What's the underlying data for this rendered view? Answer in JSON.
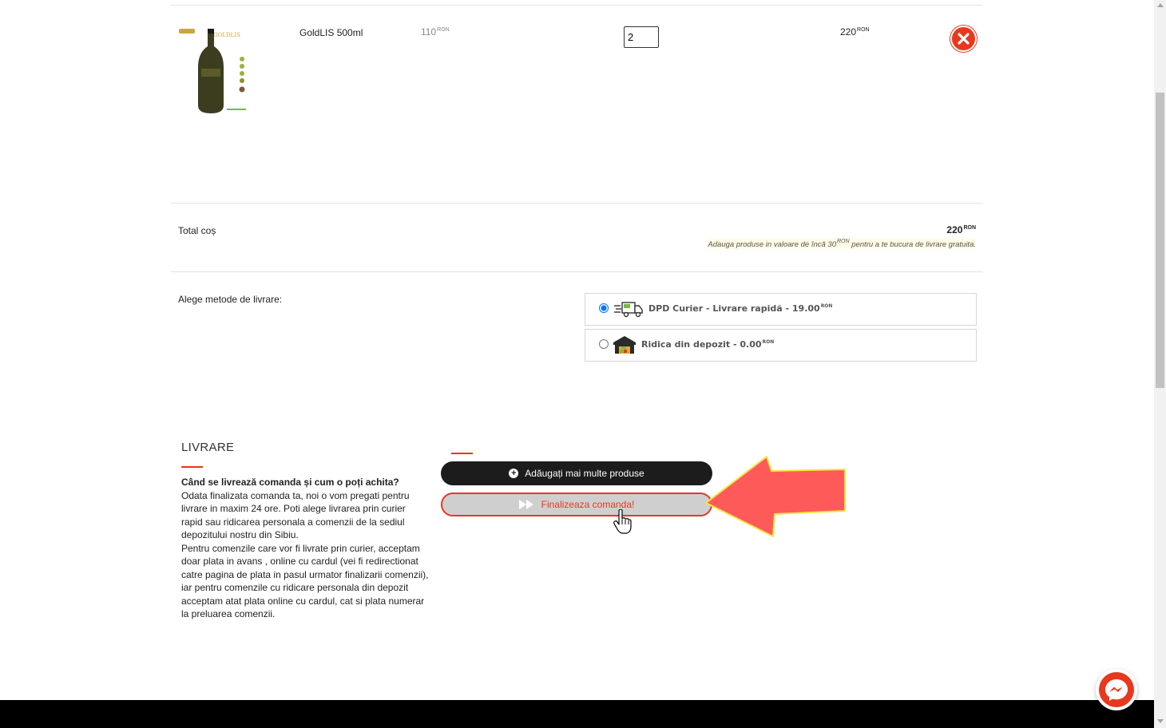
{
  "cart": {
    "items": [
      {
        "name": "GoldLIS 500ml",
        "unit_price": "110",
        "currency": "RON",
        "quantity": "2",
        "subtotal": "220",
        "image_label": "GOLDLIS"
      }
    ],
    "total_label": "Total coș",
    "total_value": "220",
    "currency": "RON",
    "free_shipping_pre": "Adauga produse in valoare de încă 30",
    "free_shipping_post": "pentru a te bucura de livrare gratuita."
  },
  "shipping": {
    "label": "Alege metode de livrare:",
    "options": [
      {
        "label": "DPD Curier - Livrare rapidă - 19.00",
        "currency": "RON",
        "selected": true,
        "icon": "truck-icon"
      },
      {
        "label": "Ridica din depozit - 0.00",
        "currency": "RON",
        "selected": false,
        "icon": "warehouse-icon"
      }
    ]
  },
  "delivery_info": {
    "title": "LIVRARE",
    "question": "Când se livrează comanda și cum o poți achita?",
    "paragraph1": "Odata finalizata comanda ta, noi o vom pregati pentru livrare in maxim 24 ore. Poti alege livrarea prin curier rapid sau ridicarea personala a comenzii de la sediul depozitului nostru din Sibiu.",
    "paragraph2": "Pentru comenzile care vor fi livrate prin curier, acceptam doar plata in avans , online cu cardul (vei fi redirectionat catre pagina de plata in pasul urmator finalizarii comenzii), iar pentru comenzile cu ridicare personala din depozit acceptam atat plata online cu cardul, cat si plata numerar la preluarea comenzii."
  },
  "actions": {
    "add_more_label": "Adăugați mai multe produse",
    "finish_label": "Finalizeaza comanda!"
  },
  "colors": {
    "accent": "#e8381e",
    "annotation_arrow": "#ff5a5a",
    "annotation_border": "#f5e642",
    "messenger": "#e8381e"
  }
}
